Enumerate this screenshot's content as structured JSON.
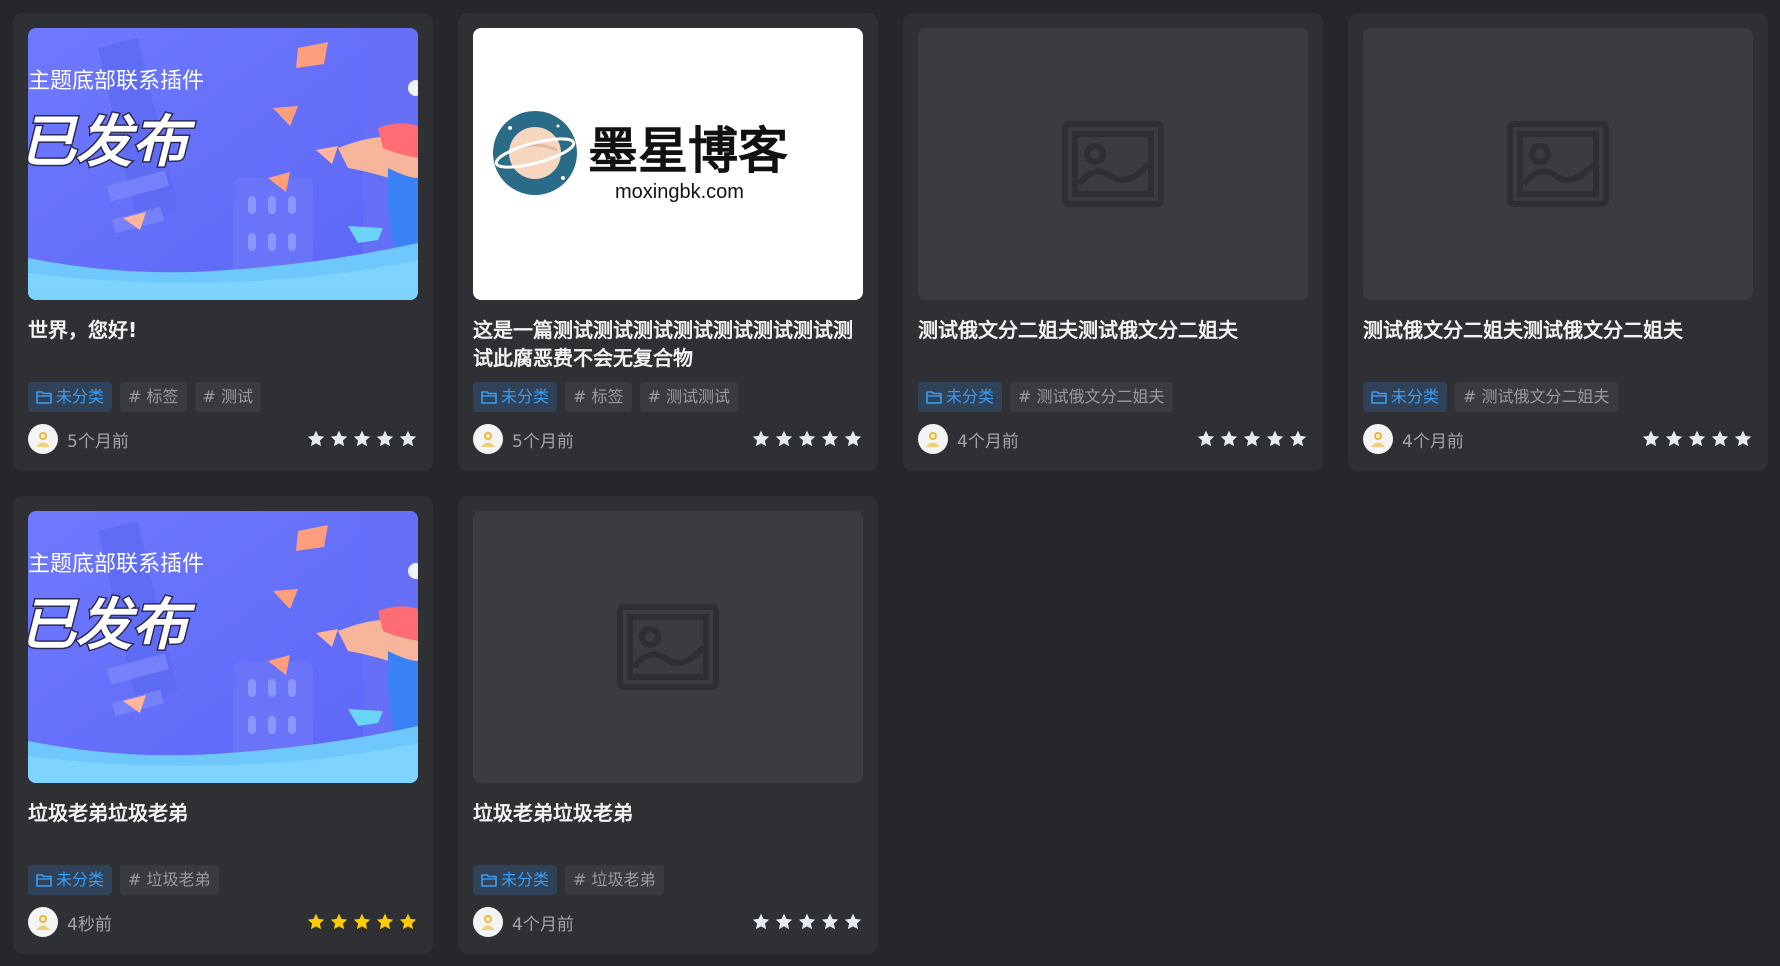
{
  "colors": {
    "page_bg": "#26272b",
    "card_bg": "#2f3034",
    "category_text": "#3b9cf1",
    "star_default": "#e6ebf2",
    "star_active": "#ffcc00"
  },
  "cards": [
    {
      "title": "世界，您好!",
      "thumbnail": "banner",
      "banner_line1": "主题底部联系插件",
      "banner_line2": "已发布",
      "category": "未分类",
      "tags": [
        "# 标签",
        "# 测试"
      ],
      "time": "5个月前",
      "rating_style": "default",
      "rating": 5
    },
    {
      "title": "这是一篇测试测试测试测试测试测试测试测试此腐恶费不会无复合物",
      "thumbnail": "logo",
      "logo_name": "墨星博客",
      "logo_domain": "moxingbk.com",
      "category": "未分类",
      "tags": [
        "# 标签",
        "# 测试测试"
      ],
      "time": "5个月前",
      "rating_style": "default",
      "rating": 5
    },
    {
      "title": "测试俄文分二姐夫测试俄文分二姐夫",
      "thumbnail": "placeholder",
      "category": "未分类",
      "tags": [
        "# 测试俄文分二姐夫"
      ],
      "time": "4个月前",
      "rating_style": "default",
      "rating": 5
    },
    {
      "title": "测试俄文分二姐夫测试俄文分二姐夫",
      "thumbnail": "placeholder",
      "category": "未分类",
      "tags": [
        "# 测试俄文分二姐夫"
      ],
      "time": "4个月前",
      "rating_style": "default",
      "rating": 5
    },
    {
      "title": "垃圾老弟垃圾老弟",
      "thumbnail": "banner",
      "banner_line1": "主题底部联系插件",
      "banner_line2": "已发布",
      "category": "未分类",
      "tags": [
        "# 垃圾老弟"
      ],
      "time": "4秒前",
      "rating_style": "active",
      "rating": 5
    },
    {
      "title": "垃圾老弟垃圾老弟",
      "thumbnail": "placeholder",
      "category": "未分类",
      "tags": [
        "# 垃圾老弟"
      ],
      "time": "4个月前",
      "rating_style": "default",
      "rating": 5
    }
  ]
}
